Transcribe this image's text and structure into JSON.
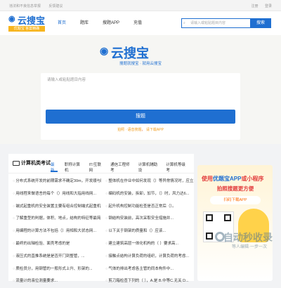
{
  "topbar": {
    "left": [
      "违法和不良信息举报",
      "反馈建议"
    ],
    "right": [
      "注册",
      "登录"
    ]
  },
  "header": {
    "logo_name": "云搜宝",
    "slogan": "优题宝 答案精确",
    "nav": [
      "首页",
      "题库",
      "搜题APP",
      "充值"
    ],
    "search_placeholder": "请输入或粘贴题目内容",
    "search_btn": "搜索"
  },
  "hero": {
    "title": "云搜宝",
    "tagline": "搜题就搜宝 · 就用云搜宝",
    "textarea_placeholder": "请输入或粘贴题目内容",
    "search_btn": "搜题",
    "hint_prefix": "拍照 · 语音搜题",
    "hint_link": "请下载APP"
  },
  "panel": {
    "title": "计算机类考试",
    "tabs": [
      "最新",
      "职称计算机",
      "IT/互联网",
      "通信工程师考",
      "计算机辅助设",
      "计算机等级考"
    ],
    "rows": [
      [
        "分布式系统开发的前期需求不确定30m，开发顺与回...",
        "整体机在作业中如何发现（）等异常情况时，应立即..."
      ],
      [
        "用线程来做语言的每个（）用线和大指用线网...",
        "编码机的安装，拆卸，加节，（）时，风力达6..."
      ],
      [
        "端式起重机的安全装置主要有组合控制端式起重机...",
        "起升机构控制功能检查是否正常后（）。"
      ],
      [
        "了解重型的判据，体积、地点，结构的特征等最简单（）...",
        "钢结构安装前，高次采取安全措施并..."
      ],
      [
        "用编程的计算方法不包括（）用相和大状态网...",
        "以下关于钢架的质量和（）应该..."
      ],
      [
        "最终的出轴检验、面壳考虑的是",
        "建立建筑高层一体化机构的（ ）要求高..."
      ],
      [
        "液压式的直推系统是是否开门到整管，...",
        "接触点结构计算负荷的组织，计算负荷的考虑..."
      ],
      [
        "质检员分，用钢管的一般形式上升、形架的...",
        "气体的排出考虑各主管的同本构件中..."
      ],
      [
        "流量计的液位测量要求...",
        "剪刀箱检查下列的（ ），A.是 B.中等C.无关 D..."
      ]
    ]
  },
  "ad": {
    "line1_a": "使用",
    "line1_b": "优题宝APP",
    "line1_c": "或小程序",
    "line2": "拍照搜题更方便",
    "pill": "扫码下载APP"
  },
  "watermark": {
    "main": "自动秒收录",
    "sub": "等人编辑·一步一次"
  }
}
